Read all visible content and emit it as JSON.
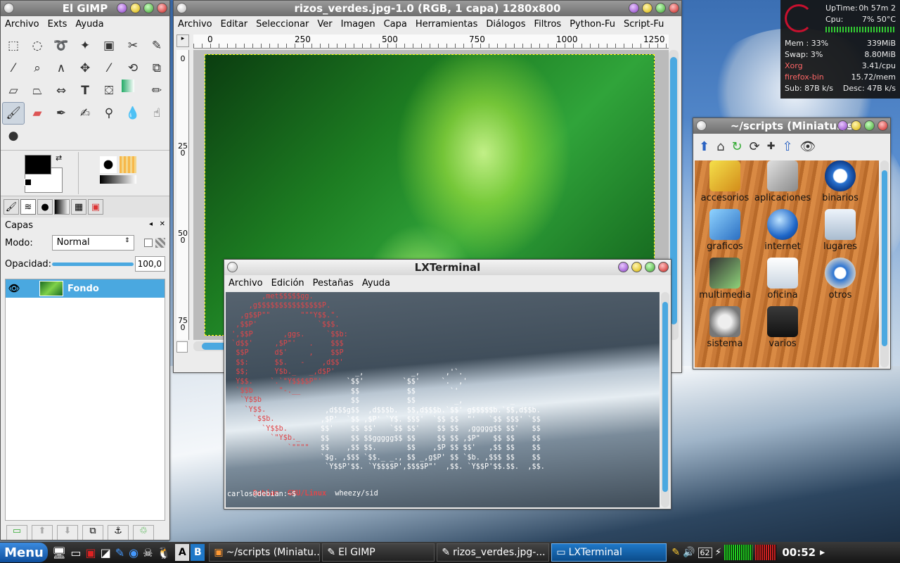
{
  "gimp_toolbox": {
    "title": "El GIMP",
    "menus": [
      "Archivo",
      "Exts",
      "Ayuda"
    ],
    "layers": {
      "tab_title": "Capas",
      "mode_label": "Modo:",
      "mode_value": "Normal",
      "opacity_label": "Opacidad:",
      "opacity_value": "100,0",
      "layer_name": "Fondo"
    }
  },
  "gimp_image": {
    "title": "rizos_verdes.jpg-1.0 (RGB, 1 capa) 1280x800",
    "menus": [
      "Archivo",
      "Editar",
      "Seleccionar",
      "Ver",
      "Imagen",
      "Capa",
      "Herramientas",
      "Diálogos",
      "Filtros",
      "Python-Fu",
      "Script-Fu"
    ],
    "ruler_top": [
      "0",
      "250",
      "500",
      "750",
      "1000",
      "1250"
    ],
    "ruler_left": [
      "0",
      "250",
      "500",
      "750"
    ]
  },
  "terminal": {
    "title": "LXTerminal",
    "menus": [
      "Archivo",
      "Edición",
      "Pestañas",
      "Ayuda"
    ],
    "ascii_swirl": "        ,met$$$$$gg.\n     ,g$$$$$$$$$$$$$$$P.\n   ,g$$P\"\"       \"\"\"Y$$.\".\n  ,$$P'              `$$$.\n ',$$P       ,ggs.     `$$b:\n `d$$'     ,$P\"'   .    $$$\n  $$P      d$'     ,    $$P\n  $$:      $$.   -    ,d$$'\n  $$;      Y$b._   _,d$P'\n  Y$$.    `.`\"Y$$$$P\"'\n  `$$b      \"-.__\n   `Y$$b\n    `Y$$.\n      `$$b.\n        `Y$$b.\n          `\"Y$b._\n              `\"\"\"\"",
    "ascii_logo": "                              _,           _,      ,'`.\n                            `$$'         `$$'     `.  ,'\n                             $$           $$        `'\n                             $$           $$         _,           _\n                       ,d$$$g$$  ,d$$$b.  $$,d$$$b.`$$' g$$$$$b.`$$,d$$b.\n                      ,$P'  `$$ ,$P' `Y$. $$$'  `$$ $$  \"'   `$$ $$$' `$$\n                      $$'    $$ $$'   `$$ $$'    $$ $$  ,ggggg$$ $$'   $$\n                      $$     $$ $$ggggg$$ $$     $$ $$ ,$P\"   $$ $$    $$\n                      $$    ,$$ $$.       $$    ,$P $$ $$'   ,$$ $$    $$\n                      `$g. ,$$$ `$$._ _., $$ _,g$P' $$ `$b. ,$$$ $$    $$\n                       `Y$$P'$$. `Y$$$$P',$$$$P\"'  ,$$. `Y$$P'$$.$$.  ,$$.",
    "distro_line_a": "Debian  GNU/Linux",
    "distro_line_b": "wheezy/sid",
    "prompt": "carlos@debian:~$"
  },
  "file_manager": {
    "title": "~/scripts (Miniatur)s",
    "items": [
      "accesorios",
      "aplicaciones",
      "binarios",
      "graficos",
      "internet",
      "lugares",
      "multimedia",
      "oficina",
      "otros",
      "sistema",
      "varios"
    ]
  },
  "conky": {
    "uptime_label": "UpTime:",
    "uptime_value": "0h 57m 2",
    "cpu_label": "Cpu:",
    "cpu_value": "7% 50°C",
    "mem_label": "Mem : 33%",
    "mem_value": "339MiB",
    "swap_label": "Swap: 3%",
    "swap_value": "8.80MiB",
    "proc1_name": "Xorg",
    "proc1_value": "3.41/cpu",
    "proc2_name": "firefox-bin",
    "proc2_value": "15.72/mem",
    "sub_label": "Sub: 87B  k/s",
    "desc_label": "Desc: 47B  k/s"
  },
  "taskbar": {
    "menu_label": "Menu",
    "workspace_a": "A",
    "workspace_b": "B",
    "tasks": [
      "~/scripts (Miniatu...",
      "El GIMP",
      "rizos_verdes.jpg-...",
      "LXTerminal"
    ],
    "volume": "62",
    "clock": "00:52"
  },
  "colors": {
    "terminal_red": "#e0474a",
    "task_active": "#1f78c8",
    "selection_blue": "#4aa8e0"
  }
}
